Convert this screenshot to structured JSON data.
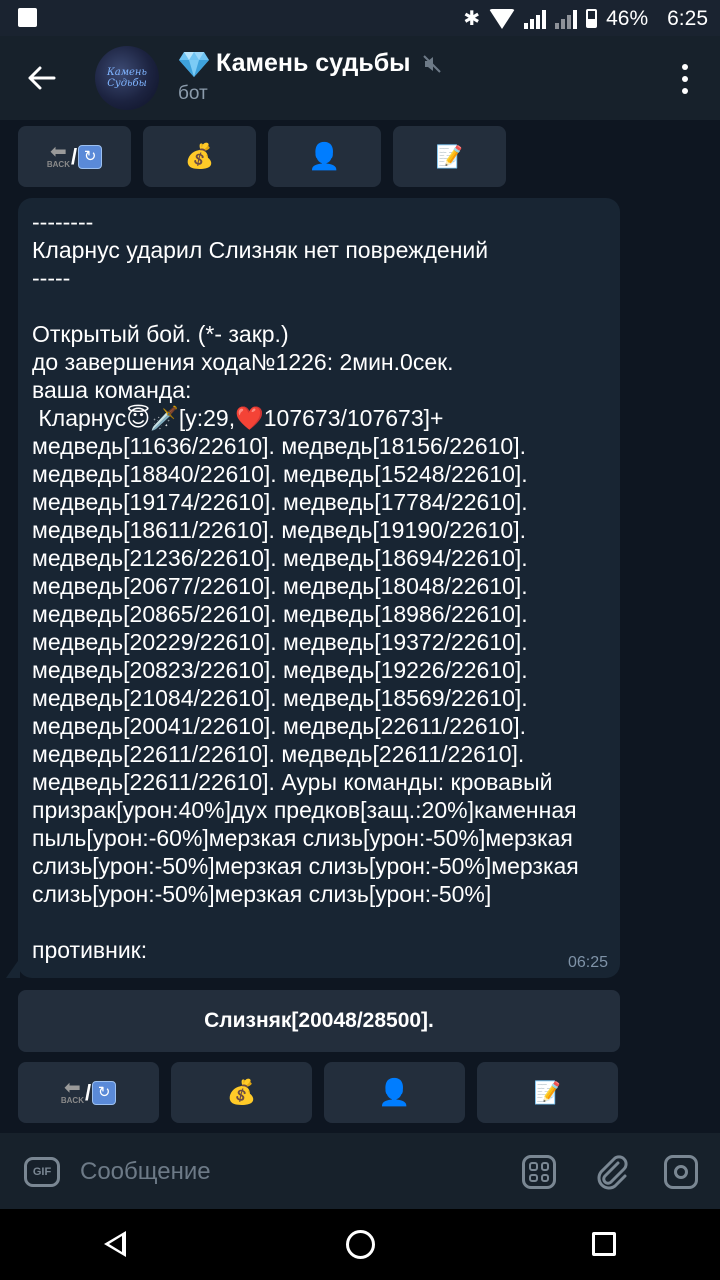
{
  "status_bar": {
    "battery": "46%",
    "time": "6:25"
  },
  "header": {
    "title": "Камень судьбы",
    "subtitle": "бот",
    "avatar_text": "Камень Судьбы"
  },
  "keyboard_top": [
    "back",
    "money-bag",
    "bust",
    "memo"
  ],
  "message": {
    "text": "--------\nКларнус ударил Слизняк нет повреждений\n-----\n\nОткрытый бой. (*- закр.)\nдо завершения хода№1226: 2мин.0сек.\nваша команда:\n Кларнус😇🗡️[у:29,❤️107673/107673]+\nмедведь[11636/22610]. медведь[18156/22610].\nмедведь[18840/22610]. медведь[15248/22610].\nмедведь[19174/22610]. медведь[17784/22610].\nмедведь[18611/22610]. медведь[19190/22610].\nмедведь[21236/22610]. медведь[18694/22610].\nмедведь[20677/22610]. медведь[18048/22610].\nмедведь[20865/22610]. медведь[18986/22610].\nмедведь[20229/22610]. медведь[19372/22610].\nмедведь[20823/22610]. медведь[19226/22610].\nмедведь[21084/22610]. медведь[18569/22610].\nмедведь[20041/22610]. медведь[22611/22610].\nмедведь[22611/22610]. медведь[22611/22610].\nмедведь[22611/22610]. Ауры команды: кровавый\nпризрак[урон:40%]дух предков[защ.:20%]каменная\nпыль[урон:-60%]мерзкая слизь[урон:-50%]мерзкая\nслизь[урон:-50%]мерзкая слизь[урон:-50%]мерзкая\nслизь[урон:-50%]мерзкая слизь[урон:-50%]\n\nпротивник:",
    "time": "06:25"
  },
  "inline_button": {
    "label": "Слизняк[20048/28500]."
  },
  "back_icon_word": "BACK",
  "input": {
    "placeholder": "Сообщение",
    "gif_label": "GIF"
  },
  "colors": {
    "background": "#0e1621",
    "header": "#17212b",
    "bubble": "#182533",
    "button": "#232e3c",
    "secondary_text": "#7f93a8"
  }
}
